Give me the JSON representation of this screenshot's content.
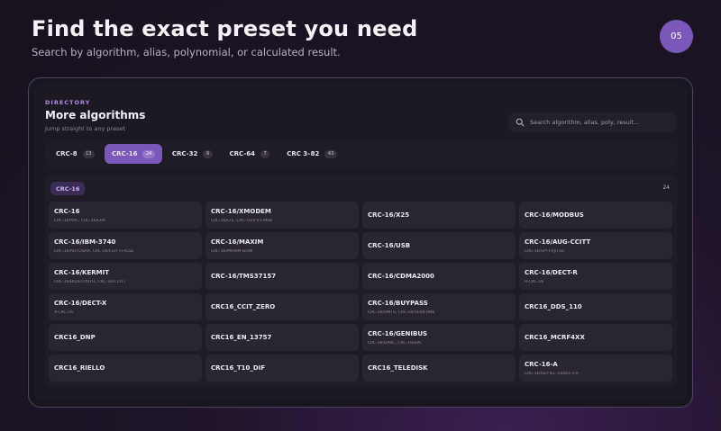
{
  "hero": {
    "title": "Find the exact preset you need",
    "subtitle": "Search by algorithm, alias, polynomial, or calculated result.",
    "step": "05"
  },
  "panel": {
    "section_label": "DIRECTORY",
    "title": "More algorithms",
    "subtitle": "Jump straight to any preset",
    "search_placeholder": "Search algorithm, alias, poly, result..."
  },
  "tabs": [
    {
      "label": "CRC-8",
      "count": "13"
    },
    {
      "label": "CRC-16",
      "count": "24"
    },
    {
      "label": "CRC-32",
      "count": "9"
    },
    {
      "label": "CRC-64",
      "count": "7"
    },
    {
      "label": "CRC 3–82",
      "count": "43"
    }
  ],
  "active_tab": 1,
  "group": {
    "label": "CRC-16",
    "count": "24",
    "items": [
      {
        "name": "CRC-16",
        "alias": "CRC-16/ARC, CRC-16/LHA"
      },
      {
        "name": "CRC-16/XMODEM",
        "alias": "CRC-16/LTE, CRC-16/V-41-MSB"
      },
      {
        "name": "CRC-16/X25",
        "alias": ""
      },
      {
        "name": "CRC-16/MODBUS",
        "alias": ""
      },
      {
        "name": "CRC-16/IBM-3740",
        "alias": "CRC-16/AUTOSAR, CRC-16/CCITT-FALSE"
      },
      {
        "name": "CRC-16/MAXIM",
        "alias": "CRC-16/MAXIM-DOW"
      },
      {
        "name": "CRC-16/USB",
        "alias": ""
      },
      {
        "name": "CRC-16/AUG-CCITT",
        "alias": "CRC-16/SPI-FUJITSU"
      },
      {
        "name": "CRC-16/KERMIT",
        "alias": "CRC-16/BLUETOOTH, CRC-16/CCITT"
      },
      {
        "name": "CRC-16/TMS37157",
        "alias": ""
      },
      {
        "name": "CRC-16/CDMA2000",
        "alias": ""
      },
      {
        "name": "CRC-16/DECT-R",
        "alias": "R-CRC-16"
      },
      {
        "name": "CRC-16/DECT-X",
        "alias": "X-CRC-16"
      },
      {
        "name": "CRC16_CCIT_ZERO",
        "alias": ""
      },
      {
        "name": "CRC-16/BUYPASS",
        "alias": "CRC-16/UMTS, CRC-16/VERIFONE"
      },
      {
        "name": "CRC16_DDS_110",
        "alias": ""
      },
      {
        "name": "CRC16_DNP",
        "alias": ""
      },
      {
        "name": "CRC16_EN_13757",
        "alias": ""
      },
      {
        "name": "CRC-16/GENIBUS",
        "alias": "CRC-16/DARC, CRC-16/EPC"
      },
      {
        "name": "CRC16_MCRF4XX",
        "alias": ""
      },
      {
        "name": "CRC16_RIELLO",
        "alias": ""
      },
      {
        "name": "CRC16_T10_DIF",
        "alias": ""
      },
      {
        "name": "CRC16_TELEDISK",
        "alias": ""
      },
      {
        "name": "CRC-16-A",
        "alias": "CRC-16/ISO-IEC-14443-3-A"
      }
    ]
  }
}
